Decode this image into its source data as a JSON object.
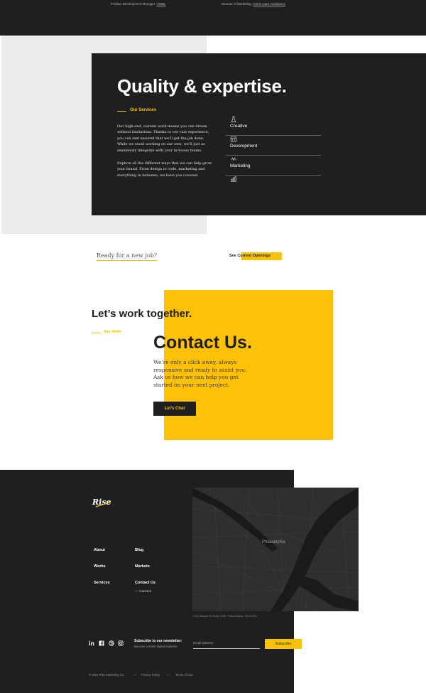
{
  "top": {
    "left_caption": "Product Development Manager, ",
    "left_link": "UWBL",
    "right_caption": "Director of Marketing, ",
    "right_link": "Home Care Assistance"
  },
  "services": {
    "title": "Quality & expertise.",
    "eyebrow": "Our Services",
    "paragraph_1": "Our high-end, custom work means you can dream without limitations. Thanks to our vast experience, you can rest assured that we’ll get the job done. While we excel working on our own, we’ll just as seamlessly integrate with your in-house teams.",
    "paragraph_2": "Explore all the different ways that we can help grow your brand. From design to code, marketing and everything in between, we have you covered.",
    "items": [
      {
        "label": "Creative",
        "icon": "flask-icon"
      },
      {
        "label": "Development",
        "icon": "code-window-icon"
      },
      {
        "label": "Marketing",
        "icon": "megaphone-icon"
      },
      {
        "label": "",
        "icon": "bar-chart-icon"
      }
    ]
  },
  "jobs": {
    "ready_text": "Ready for a new job?",
    "openings_link": "See Current Openings"
  },
  "contact": {
    "work_title": "Let’s work together.",
    "hello": "Say Hello",
    "title": "Contact Us.",
    "paragraph": "We’re only a click away, always responsive and ready to assist you. Ask us how we can help you get started on your next project.",
    "button": "Let’s Chat"
  },
  "footer": {
    "logo_text": "Rise",
    "links_col1": [
      "About",
      "Works",
      "Services"
    ],
    "links_col2": [
      "Blog",
      "Markets",
      "Contact Us"
    ],
    "careers": "Careers",
    "map_city": "Philadelphia",
    "map_caption": "1700 Market St Suite 1005, Philadelphia, PA 19103",
    "social": [
      "linkedin-icon",
      "facebook-icon",
      "dribbble-icon",
      "instagram-icon"
    ],
    "newsletter_title": "Subscribe to our newsletter:",
    "newsletter_sub": "Become a better digital marketer.",
    "email_placeholder": "Email address",
    "subscribe": "Subscribe",
    "copyright": "© 2021 Rise Marketing Co.",
    "privacy": "Privacy Policy",
    "terms": "Terms of Use"
  },
  "colors": {
    "accent": "#fdc108",
    "dark": "#1f1f1f",
    "panel_gray": "#ececec"
  }
}
